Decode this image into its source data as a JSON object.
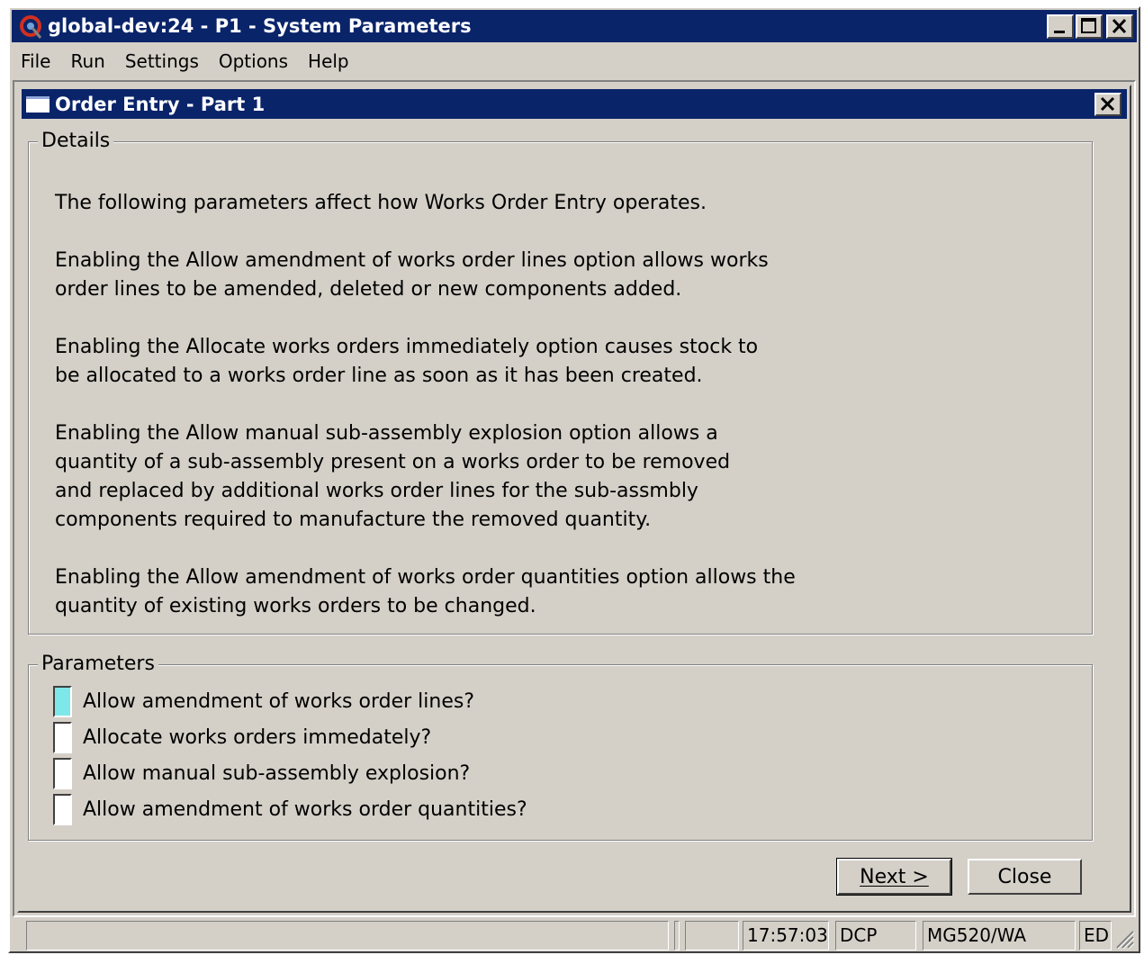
{
  "window": {
    "title": "global-dev:24 - P1 - System Parameters"
  },
  "menu": [
    "File",
    "Run",
    "Settings",
    "Options",
    "Help"
  ],
  "child": {
    "title": "Order Entry - Part 1",
    "details": {
      "legend": "Details",
      "paragraphs": [
        "The following parameters affect how Works Order Entry operates.",
        "Enabling the Allow amendment of works order lines option allows works",
        "order lines to be amended, deleted or new components added.",
        "Enabling the Allocate works orders immediately option causes stock to",
        "be allocated to a works order line as soon as it has been created.",
        "Enabling the Allow manual sub-assembly explosion option allows a",
        "quantity of a sub-assembly present on a works order to be removed",
        "and replaced by additional works order lines for the sub-assmbly",
        "components required to manufacture the removed quantity.",
        "Enabling the Allow amendment of works order quantities option allows the",
        "quantity of existing works orders to be changed."
      ]
    },
    "parameters": {
      "legend": "Parameters",
      "items": [
        {
          "label": "Allow amendment of works order lines?",
          "checked": false
        },
        {
          "label": "Allocate works orders immedately?",
          "checked": false
        },
        {
          "label": "Allow manual sub-assembly explosion?",
          "checked": false
        },
        {
          "label": "Allow amendment of works order quantities?",
          "checked": false
        }
      ]
    },
    "buttons": {
      "next": "Next >",
      "close": "Close"
    }
  },
  "status": {
    "time": "17:57:03",
    "company": "DCP",
    "program": "MG520/WA",
    "mode": "ED"
  }
}
